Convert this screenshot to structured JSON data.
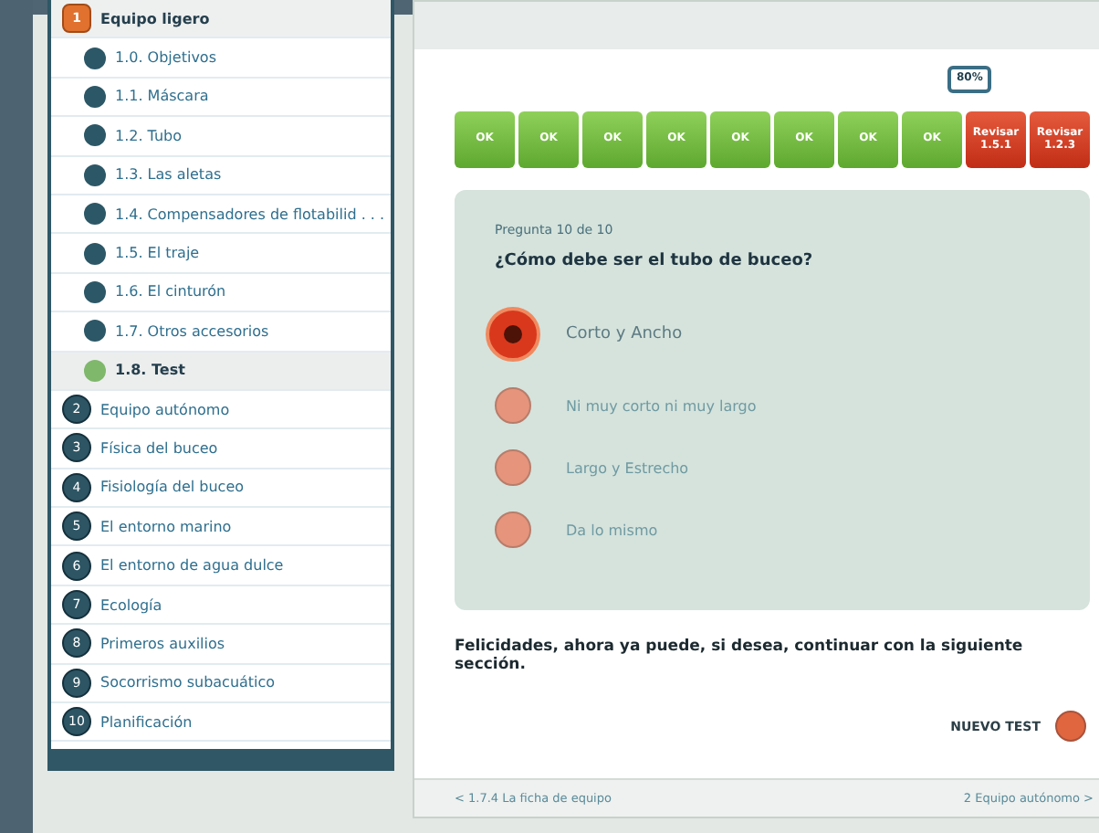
{
  "sidebar": {
    "sections": [
      {
        "number": "1",
        "label": "Equipo ligero",
        "expanded": true,
        "children": [
          {
            "label": "1.0. Objetivos",
            "selected": false
          },
          {
            "label": "1.1. Máscara",
            "selected": false
          },
          {
            "label": "1.2. Tubo",
            "selected": false
          },
          {
            "label": "1.3. Las aletas",
            "selected": false
          },
          {
            "label": "1.4. Compensadores de flotabilid . . .",
            "selected": false
          },
          {
            "label": "1.5. El traje",
            "selected": false
          },
          {
            "label": "1.6. El cinturón",
            "selected": false
          },
          {
            "label": "1.7. Otros accesorios",
            "selected": false
          },
          {
            "label": "1.8. Test",
            "selected": true
          }
        ]
      },
      {
        "number": "2",
        "label": "Equipo autónomo",
        "expanded": false
      },
      {
        "number": "3",
        "label": "Física del buceo",
        "expanded": false
      },
      {
        "number": "4",
        "label": "Fisiología del buceo",
        "expanded": false
      },
      {
        "number": "5",
        "label": "El entorno marino",
        "expanded": false
      },
      {
        "number": "6",
        "label": "El entorno de agua dulce",
        "expanded": false
      },
      {
        "number": "7",
        "label": "Ecología",
        "expanded": false
      },
      {
        "number": "8",
        "label": "Primeros auxilios",
        "expanded": false
      },
      {
        "number": "9",
        "label": "Socorrismo subacuático",
        "expanded": false
      },
      {
        "number": "10",
        "label": "Planificación",
        "expanded": false
      }
    ]
  },
  "progress": {
    "score": "80%",
    "cells": [
      {
        "kind": "ok",
        "label": "OK"
      },
      {
        "kind": "ok",
        "label": "OK"
      },
      {
        "kind": "ok",
        "label": "OK"
      },
      {
        "kind": "ok",
        "label": "OK"
      },
      {
        "kind": "ok",
        "label": "OK"
      },
      {
        "kind": "ok",
        "label": "OK"
      },
      {
        "kind": "ok",
        "label": "OK"
      },
      {
        "kind": "ok",
        "label": "OK"
      },
      {
        "kind": "review",
        "label": "Revisar 1.5.1"
      },
      {
        "kind": "review",
        "label": "Revisar 1.2.3"
      }
    ]
  },
  "question": {
    "counter": "Pregunta 10 de 10",
    "text": "¿Cómo debe ser el tubo de buceo?",
    "answers": [
      {
        "label": "Corto y Ancho",
        "selected": true
      },
      {
        "label": "Ni muy corto ni muy largo",
        "selected": false
      },
      {
        "label": "Largo y Estrecho",
        "selected": false
      },
      {
        "label": "Da lo mismo",
        "selected": false
      }
    ]
  },
  "message": "Felicidades, ahora ya puede, si desea, continuar con la siguiente sección.",
  "new_test": "NUEVO TEST",
  "footer": {
    "previous": "< 1.7.4 La ficha de equipo",
    "next": "2 Equipo autónomo >"
  }
}
